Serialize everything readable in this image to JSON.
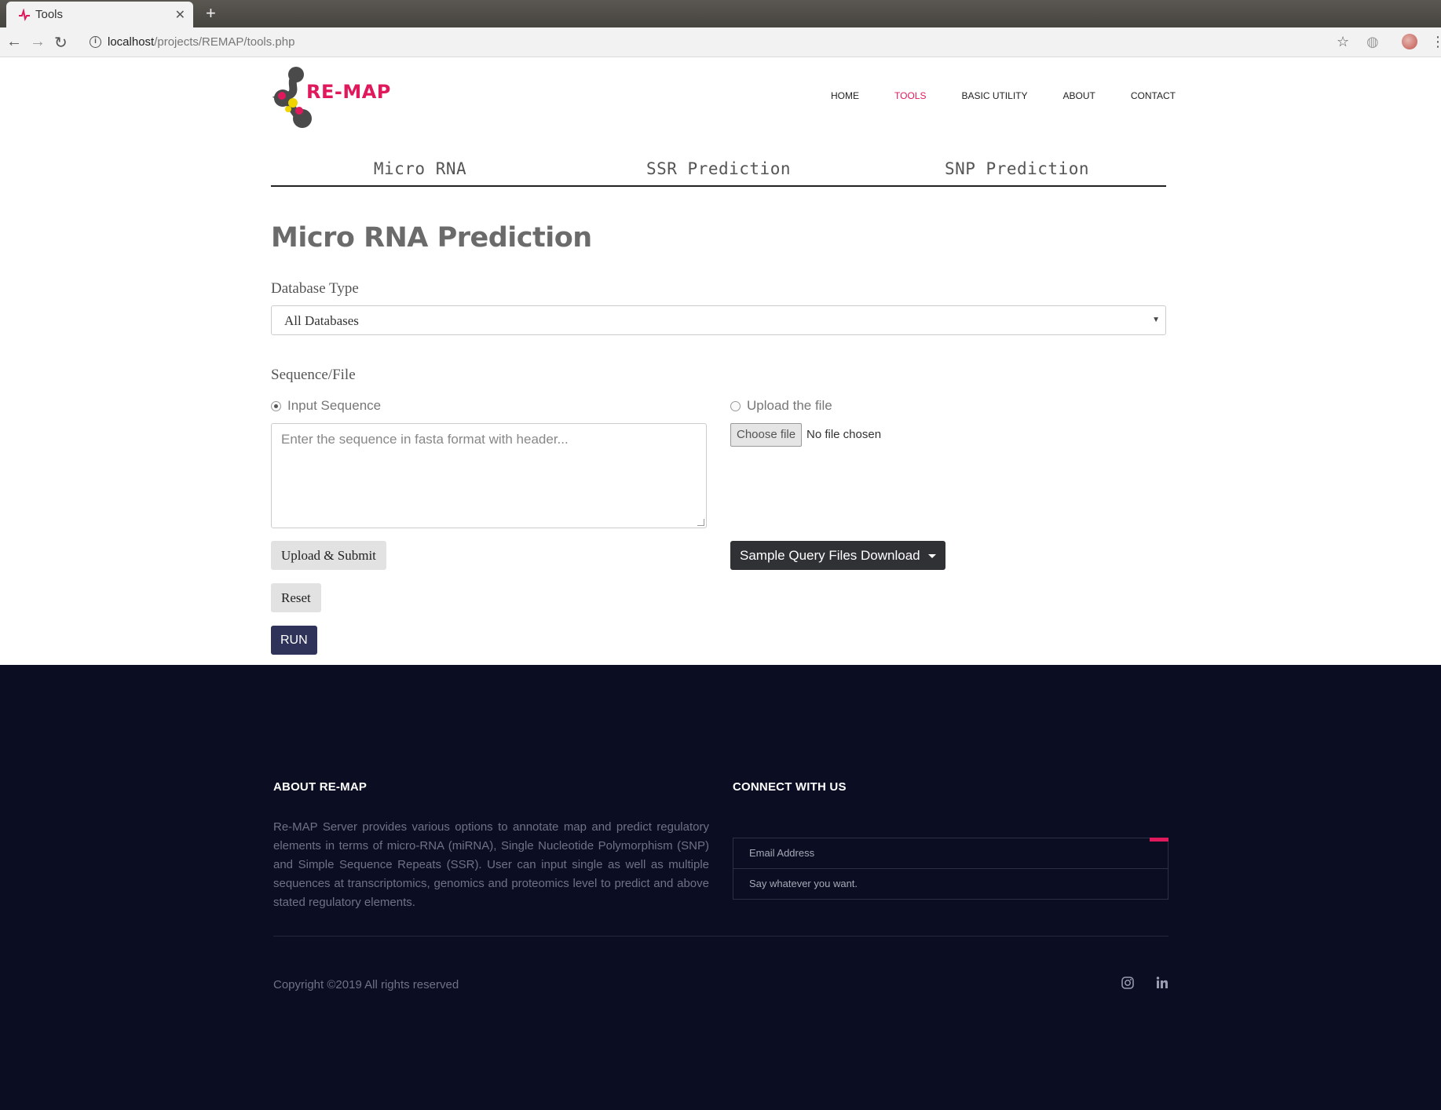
{
  "browser": {
    "tab_title": "Tools",
    "url_host": "localhost",
    "url_path": "/projects/REMAP/tools.php"
  },
  "site": {
    "logo_text": "RE-MAP",
    "nav": [
      {
        "label": "HOME",
        "active": false
      },
      {
        "label": "TOOLS",
        "active": true
      },
      {
        "label": "BASIC UTILITY",
        "active": false
      },
      {
        "label": "ABOUT",
        "active": false
      },
      {
        "label": "CONTACT",
        "active": false
      }
    ],
    "accent_color": "#e0195c"
  },
  "tool_tabs": [
    "Micro RNA",
    "SSR Prediction",
    "SNP Prediction"
  ],
  "form": {
    "title": "Micro RNA Prediction",
    "database_label": "Database Type",
    "database_value": "All Databases",
    "sequence_label": "Sequence/File",
    "radio_input": "Input Sequence",
    "radio_upload": "Upload the file",
    "textarea_placeholder": "Enter the sequence in fasta format with header...",
    "choose_file": "Choose file",
    "file_status": "No file chosen",
    "upload_submit": "Upload & Submit",
    "sample_download": "Sample Query Files Download",
    "reset": "Reset",
    "run": "RUN"
  },
  "footer": {
    "about_heading": "ABOUT RE-MAP",
    "about_text": "Re-MAP Server provides various options to annotate map and predict regulatory elements in terms of micro-RNA (miRNA), Single Nucleotide Polymorphism (SNP) and Simple Sequence Repeats (SSR). User can input single as well as multiple sequences at transcriptomics, genomics and proteomics level to predict and above stated regulatory elements.",
    "connect_heading": "CONNECT WITH US",
    "email_placeholder": "Email Address",
    "message_placeholder": "Say whatever you want.",
    "copyright": "Copyright ©2019 All rights reserved",
    "social": [
      "instagram-icon",
      "linkedin-icon"
    ]
  }
}
